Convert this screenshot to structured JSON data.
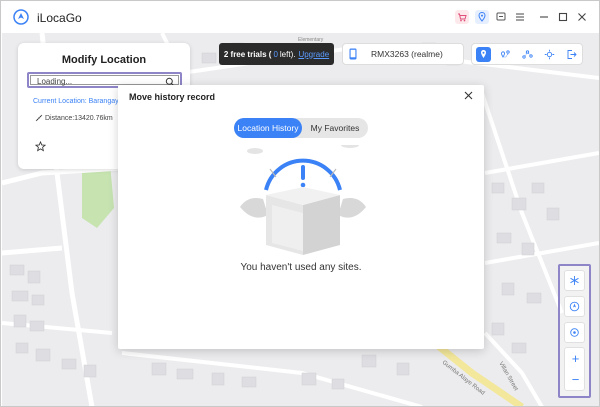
{
  "app": {
    "title": "iLocaGo"
  },
  "titlebar": {
    "icons": [
      "cart-icon",
      "location-pin-icon",
      "feedback-icon",
      "menu-icon",
      "minimize-icon",
      "maximize-icon",
      "close-icon"
    ]
  },
  "map": {
    "labels": {
      "elementary": "Elementary",
      "street_1": "Gumba Alaye Road",
      "street_2": "Villan Street"
    }
  },
  "modify_location": {
    "title": "Modify Location",
    "search_value": "Loading...",
    "current_location": "Current Location: Barangay",
    "distance": "Distance:13420.76km"
  },
  "trial": {
    "prefix": "2 free trials (",
    "count": "0",
    "suffix": "left).",
    "upgrade_label": "Upgrade"
  },
  "device": {
    "name": "RMX3263 (realme)"
  },
  "modes": {
    "items": [
      "teleport-mode-icon",
      "two-spot-mode-icon",
      "multi-spot-mode-icon",
      "joystick-mode-icon",
      "exit-icon"
    ],
    "active": "teleport-mode-icon"
  },
  "side_controls": {
    "items": [
      "snowflake-icon",
      "compass-icon",
      "locate-icon"
    ],
    "zoom_in": "+",
    "zoom_out": "−"
  },
  "modal": {
    "title": "Move history record",
    "tabs": [
      {
        "label": "Location History",
        "active": true
      },
      {
        "label": "My Favorites",
        "active": false
      }
    ],
    "empty_message": "You haven't used any sites."
  },
  "colors": {
    "accent": "#3b82f6",
    "highlight_border": "#8d85c7",
    "banner_bg": "#2b2b2b",
    "map_bg": "#eeeef0",
    "park_green": "#c6e3b0",
    "road_yellow": "#f3e79b"
  }
}
